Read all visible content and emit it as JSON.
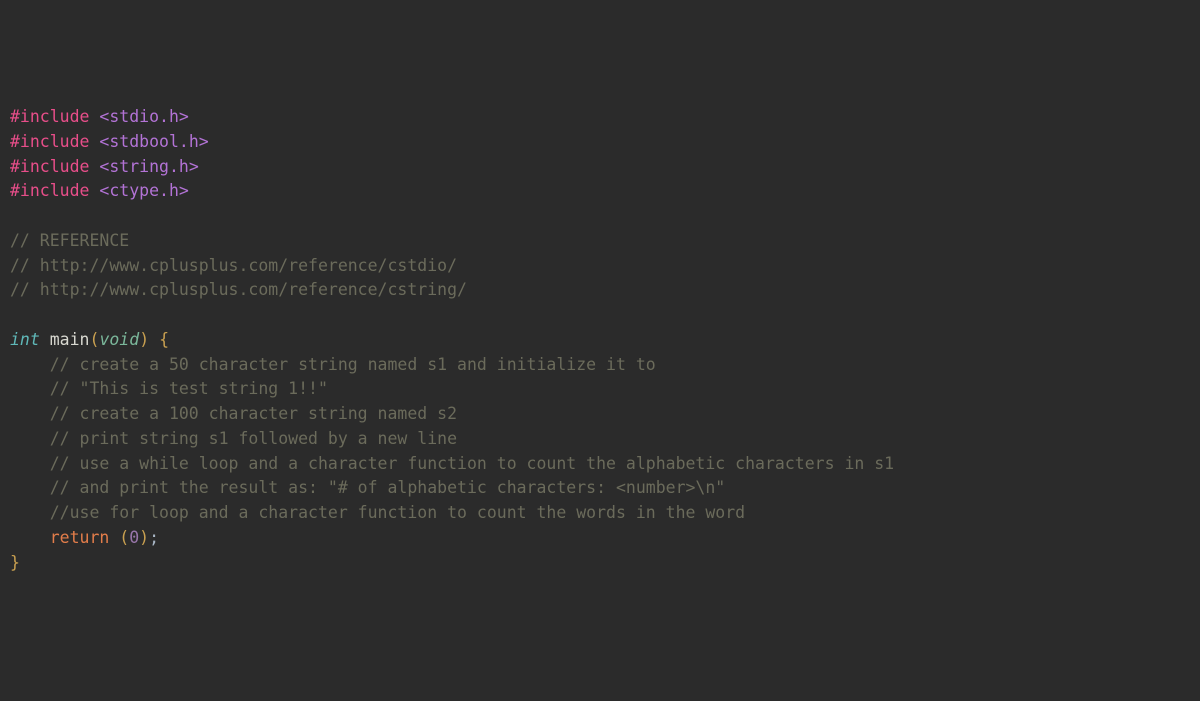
{
  "code": {
    "includes": [
      {
        "directive": "#include",
        "header": "<stdio.h>"
      },
      {
        "directive": "#include",
        "header": "<stdbool.h>"
      },
      {
        "directive": "#include",
        "header": "<string.h>"
      },
      {
        "directive": "#include",
        "header": "<ctype.h>"
      }
    ],
    "reference_comments": [
      "// REFERENCE",
      "// http://www.cplusplus.com/reference/cstdio/",
      "// http://www.cplusplus.com/reference/cstring/"
    ],
    "main_signature": {
      "return_type": "int",
      "name": "main",
      "param_type": "void",
      "open_brace": "{"
    },
    "body_comments": [
      "    // create a 50 character string named s1 and initialize it to",
      "    // \"This is test string 1!!\"",
      "",
      "    // create a 100 character string named s2",
      "",
      "    // print string s1 followed by a new line",
      "",
      "    // use a while loop and a character function to count the alphabetic characters in s1",
      "    // and print the result as: \"# of alphabetic characters: <number>\\n\"",
      "",
      "    //use for loop and a character function to count the words in the word",
      "",
      ""
    ],
    "return_stmt": {
      "indent": "    ",
      "keyword": "return",
      "open_paren": "(",
      "value": "0",
      "close_paren": ")",
      "semi": ";"
    },
    "close_brace": "}"
  }
}
